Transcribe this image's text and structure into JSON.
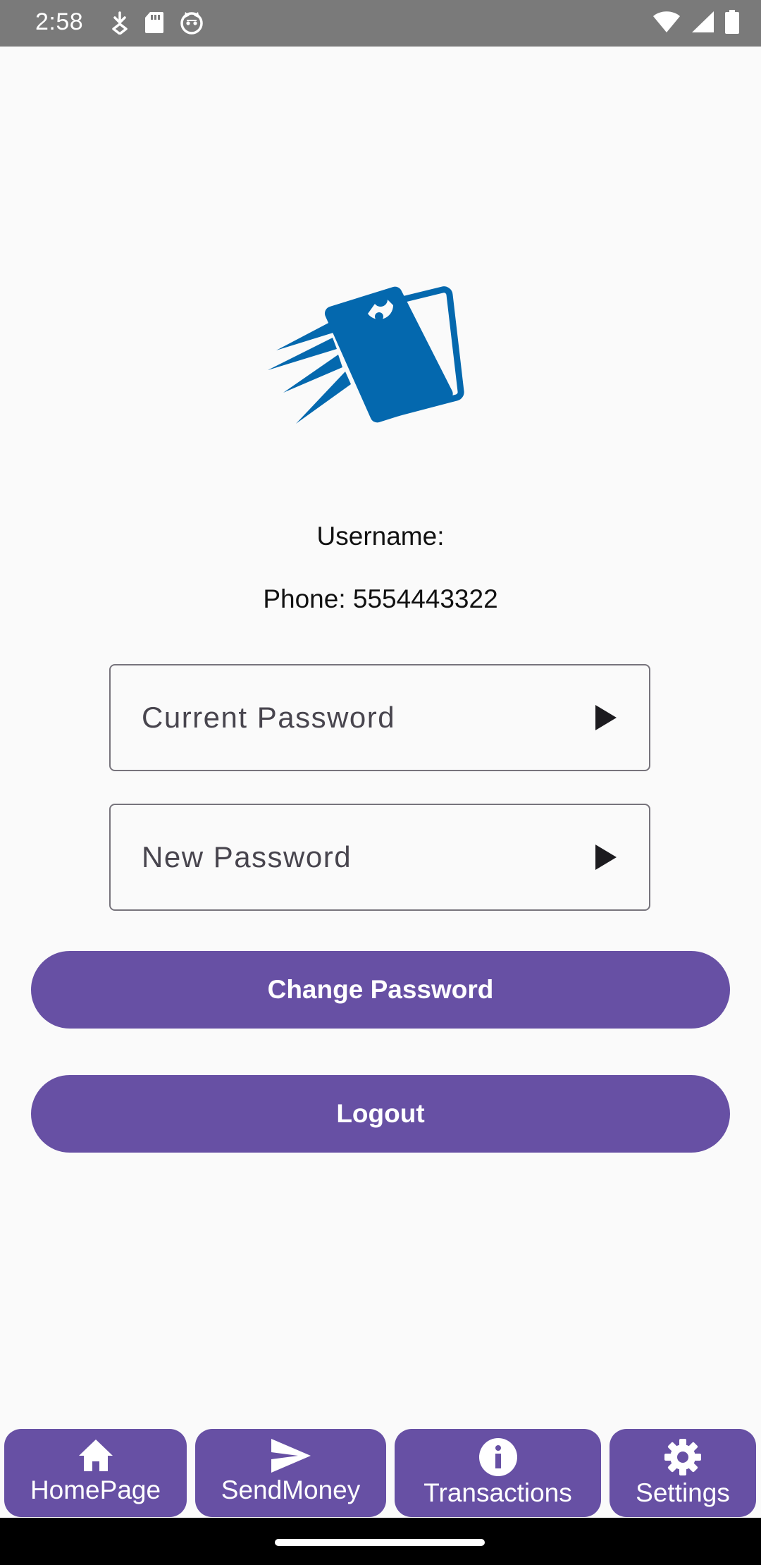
{
  "status_bar": {
    "time": "2:58",
    "left_icons": [
      "download-icon",
      "sd-card-icon",
      "cat-icon"
    ],
    "right_icons": [
      "wifi-icon",
      "signal-icon",
      "battery-icon"
    ]
  },
  "logo": {
    "icon": "wallet-logo-icon",
    "color": "#0468ae"
  },
  "profile": {
    "username_label": "Username:",
    "phone_label": "Phone: 5554443322"
  },
  "form": {
    "current_password_placeholder": "Current Password",
    "new_password_placeholder": "New Password",
    "arrow_icon": "play-arrow-icon"
  },
  "buttons": {
    "change_password": "Change Password",
    "logout": "Logout"
  },
  "bottom_nav": {
    "items": [
      {
        "label": "HomePage",
        "icon": "home-icon"
      },
      {
        "label": "SendMoney",
        "icon": "send-icon"
      },
      {
        "label": "Transactions",
        "icon": "info-icon"
      },
      {
        "label": "Settings",
        "icon": "gear-icon"
      }
    ]
  },
  "colors": {
    "primary": "#6750a4",
    "background": "#fafafa",
    "status_bar": "#7a7a7a",
    "outline": "#77747c"
  }
}
